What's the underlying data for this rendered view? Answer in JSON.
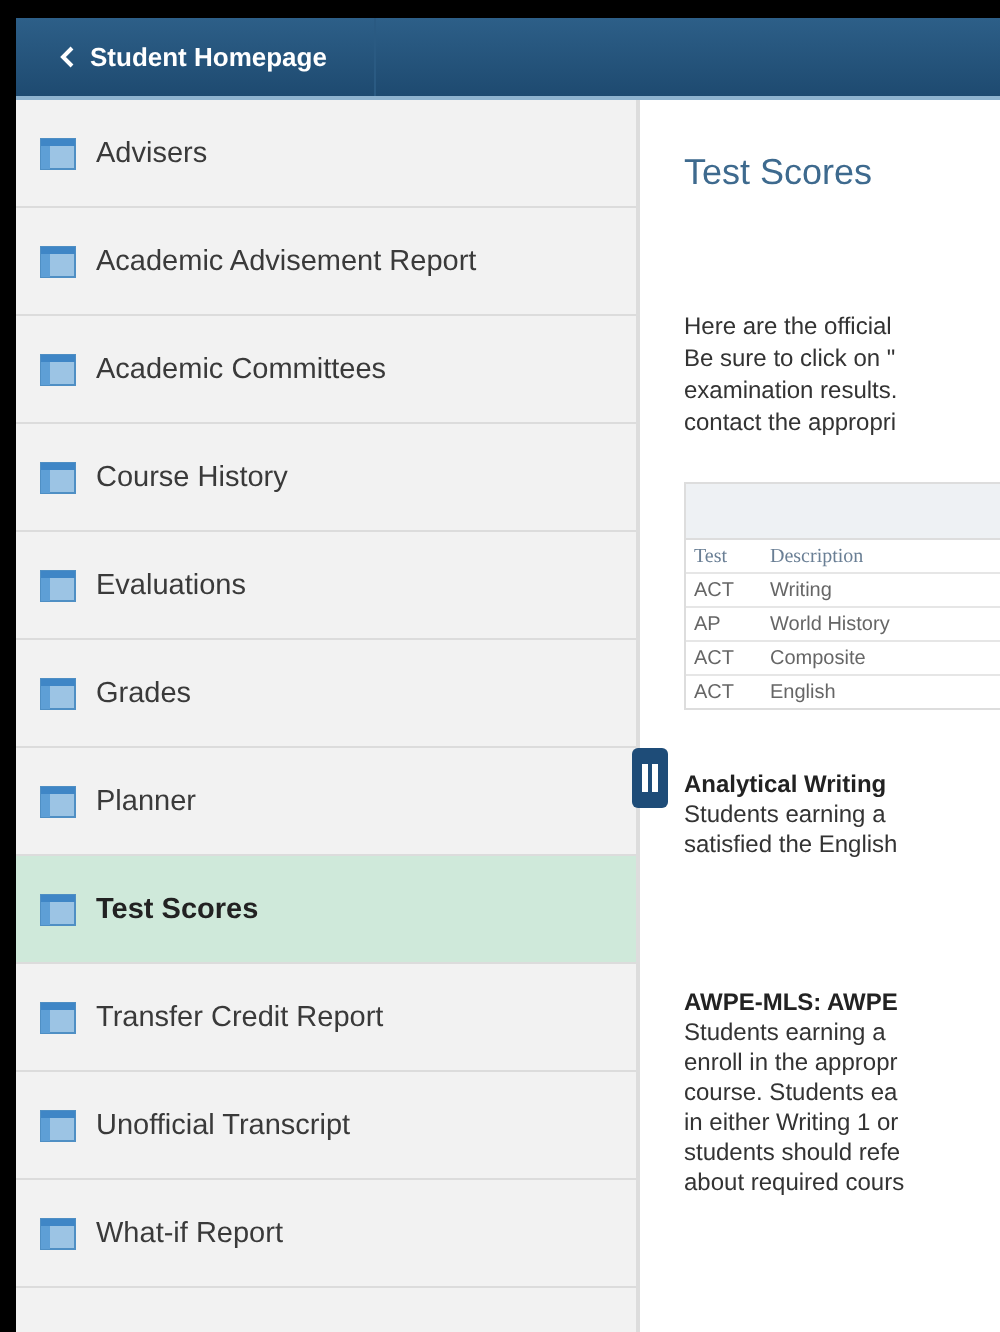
{
  "header": {
    "back_label": "Student Homepage"
  },
  "sidebar": {
    "items": [
      {
        "label": "Advisers",
        "selected": false
      },
      {
        "label": "Academic Advisement Report",
        "selected": false
      },
      {
        "label": "Academic Committees",
        "selected": false
      },
      {
        "label": "Course History",
        "selected": false
      },
      {
        "label": "Evaluations",
        "selected": false
      },
      {
        "label": "Grades",
        "selected": false
      },
      {
        "label": "Planner",
        "selected": false
      },
      {
        "label": "Test Scores",
        "selected": true
      },
      {
        "label": "Transfer Credit Report",
        "selected": false
      },
      {
        "label": "Unofficial Transcript",
        "selected": false
      },
      {
        "label": "What-if Report",
        "selected": false
      }
    ]
  },
  "content": {
    "title": "Test Scores",
    "intro_lines": [
      "Here are the official",
      "Be sure to click on \"",
      "examination results.",
      "contact the appropri"
    ],
    "table": {
      "columns": [
        "Test",
        "Description"
      ],
      "rows": [
        [
          "ACT",
          "Writing"
        ],
        [
          "AP",
          "World History"
        ],
        [
          "ACT",
          "Composite"
        ],
        [
          "ACT",
          "English"
        ]
      ]
    },
    "sections": [
      {
        "heading": "Analytical Writing",
        "lines": [
          "Students earning a",
          "satisfied the English"
        ]
      },
      {
        "heading": "AWPE-MLS: AWPE",
        "lines": [
          "Students earning a",
          "enroll in the appropr",
          "course. Students ea",
          "in either Writing 1 or",
          "students should refe",
          "about required cours"
        ]
      }
    ]
  }
}
